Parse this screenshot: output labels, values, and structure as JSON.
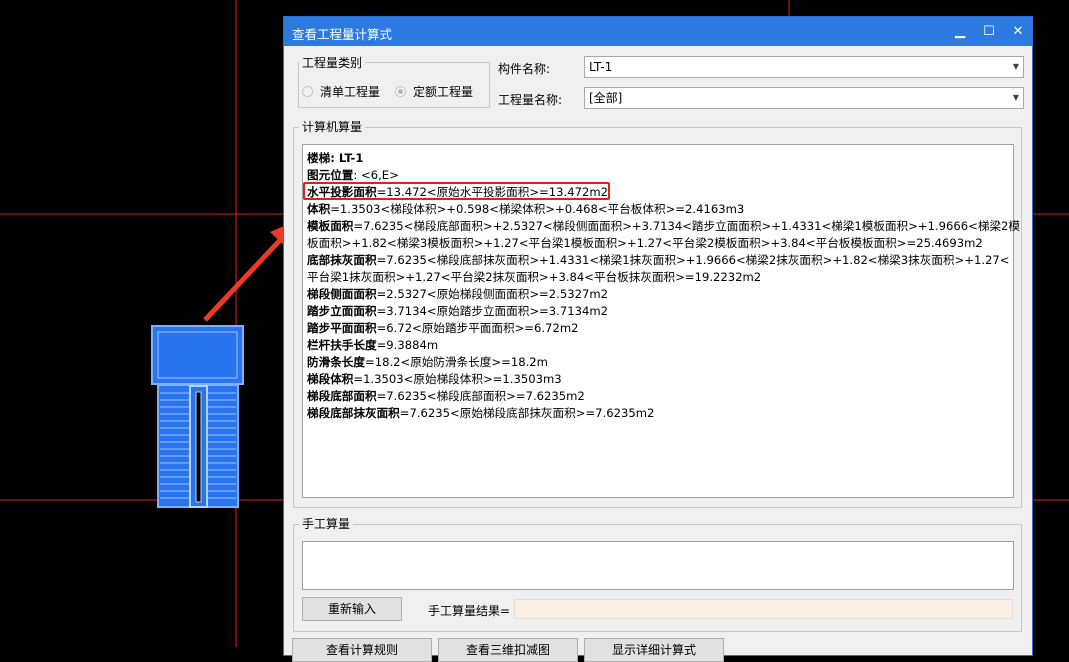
{
  "dialog": {
    "title": "查看工程量计算式",
    "minimize": "▁",
    "maximize": "☐",
    "close": "✕"
  },
  "quantity_type": {
    "group_label": "工程量类别",
    "options": [
      {
        "label": "清单工程量",
        "selected": false
      },
      {
        "label": "定额工程量",
        "selected": true
      }
    ]
  },
  "component_name": {
    "label": "构件名称:",
    "value": "LT-1"
  },
  "quantity_name": {
    "label": "工程量名称:",
    "value": "[全部]"
  },
  "computer_calc": {
    "group_label": "计算机算量",
    "lines": [
      {
        "key": "楼梯: LT-1",
        "rest": ""
      },
      {
        "key": "图元位置",
        "rest": ": <6,E>"
      },
      {
        "key": "水平投影面积",
        "rest": "=13.472<原始水平投影面积>=13.472m2"
      },
      {
        "key": "体积",
        "rest": "=1.3503<梯段体积>+0.598<梯梁体积>+0.468<平台板体积>=2.4163m3"
      },
      {
        "key": "模板面积",
        "rest": "=7.6235<梯段底部面积>+2.5327<梯段侧面面积>+3.7134<踏步立面面积>+1.4331<梯梁1模板面积>+1.9666<梯梁2模"
      },
      {
        "key": "",
        "rest": "板面积>+1.82<梯梁3模板面积>+1.27<平台梁1模板面积>+1.27<平台梁2模板面积>+3.84<平台板模板面积>=25.4693m2"
      },
      {
        "key": "底部抹灰面积",
        "rest": "=7.6235<梯段底部抹灰面积>+1.4331<梯梁1抹灰面积>+1.9666<梯梁2抹灰面积>+1.82<梯梁3抹灰面积>+1.27<"
      },
      {
        "key": "",
        "rest": "平台梁1抹灰面积>+1.27<平台梁2抹灰面积>+3.84<平台板抹灰面积>=19.2232m2"
      },
      {
        "key": "梯段侧面面积",
        "rest": "=2.5327<原始梯段侧面面积>=2.5327m2"
      },
      {
        "key": "踏步立面面积",
        "rest": "=3.7134<原始踏步立面面积>=3.7134m2"
      },
      {
        "key": "踏步平面面积",
        "rest": "=6.72<原始踏步平面面积>=6.72m2"
      },
      {
        "key": "栏杆扶手长度",
        "rest": "=9.3884m"
      },
      {
        "key": "防滑条长度",
        "rest": "=18.2<原始防滑条长度>=18.2m"
      },
      {
        "key": "梯段体积",
        "rest": "=1.3503<原始梯段体积>=1.3503m3"
      },
      {
        "key": "梯段底部面积",
        "rest": "=7.6235<梯段底部面积>=7.6235m2"
      },
      {
        "key": "梯段底部抹灰面积",
        "rest": "=7.6235<原始梯段底部抹灰面积>=7.6235m2"
      }
    ]
  },
  "manual_calc": {
    "group_label": "手工算量",
    "reenter_button": "重新输入",
    "result_label": "手工算量结果=",
    "result_value": ""
  },
  "bottom_buttons": [
    "查看计算规则",
    "查看三维扣减图",
    "显示详细计算式"
  ],
  "colors": {
    "titlebar": "#2d7be0",
    "highlight_box": "#e0201c",
    "arrow": "#ee3a25",
    "cad_lines": "#e31b1b",
    "stair_fill": "#2a74f0"
  }
}
